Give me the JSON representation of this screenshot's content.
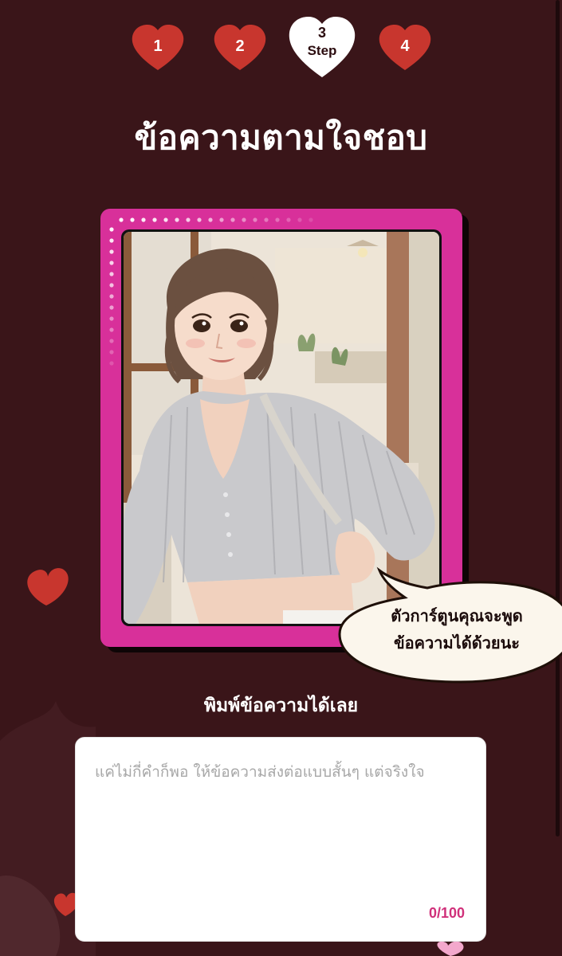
{
  "steps": [
    {
      "number": "1",
      "state": "inactive"
    },
    {
      "number": "2",
      "state": "inactive"
    },
    {
      "number": "3",
      "label": "Step",
      "state": "active"
    },
    {
      "number": "4",
      "state": "inactive"
    }
  ],
  "title": "ข้อความตามใจชอบ",
  "card": {
    "image_icon": "cartoon-character-illustration",
    "speech_bubble": {
      "line1": "ตัวการ์ตูนคุณจะพูด",
      "line2": "ข้อความได้ด้วยนะ"
    }
  },
  "message": {
    "label": "พิมพ์ข้อความได้เลย",
    "placeholder": "แค่ไม่กี่คำก็พอ ให้ข้อความส่งต่อแบบสั้นๆ แต่จริงใจ",
    "value": "",
    "counter": "0/100"
  },
  "colors": {
    "background": "#3a1519",
    "heart_red": "#c8362e",
    "card_pink": "#d8309a",
    "counter_pink": "#d0307a"
  }
}
